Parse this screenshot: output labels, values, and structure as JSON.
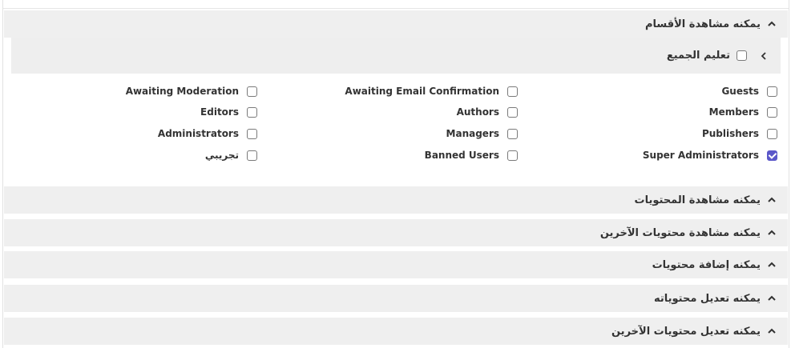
{
  "sections": [
    {
      "title": "يمكنه مشاهدة الأقسام",
      "expanded": true
    },
    {
      "title": "يمكنه مشاهدة المحتويات",
      "expanded": false
    },
    {
      "title": "يمكنه مشاهدة محتويات الآخرين",
      "expanded": false
    },
    {
      "title": "يمكنه إضافة محتويات",
      "expanded": false
    },
    {
      "title": "يمكنه تعديل محتوياته",
      "expanded": false
    },
    {
      "title": "يمكنه تعديل محتويات الآخرين",
      "expanded": false
    }
  ],
  "select_all": {
    "label": "تعليم الجميع",
    "checked": false
  },
  "groups": [
    {
      "label": "Guests",
      "checked": false
    },
    {
      "label": "Awaiting Email Confirmation",
      "checked": false
    },
    {
      "label": "Awaiting Moderation",
      "checked": false
    },
    {
      "label": "Members",
      "checked": false
    },
    {
      "label": "Authors",
      "checked": false
    },
    {
      "label": "Editors",
      "checked": false
    },
    {
      "label": "Publishers",
      "checked": false
    },
    {
      "label": "Managers",
      "checked": false
    },
    {
      "label": "Administrators",
      "checked": false
    },
    {
      "label": "Super Administrators",
      "checked": true
    },
    {
      "label": "Banned Users",
      "checked": false
    },
    {
      "label": "تجريبي",
      "checked": false
    }
  ],
  "colors": {
    "accent": "#5b57c9",
    "header_bg": "#efefef"
  },
  "icons": {
    "expanded": "chevron-up-icon",
    "submenu": "chevron-left-icon"
  }
}
